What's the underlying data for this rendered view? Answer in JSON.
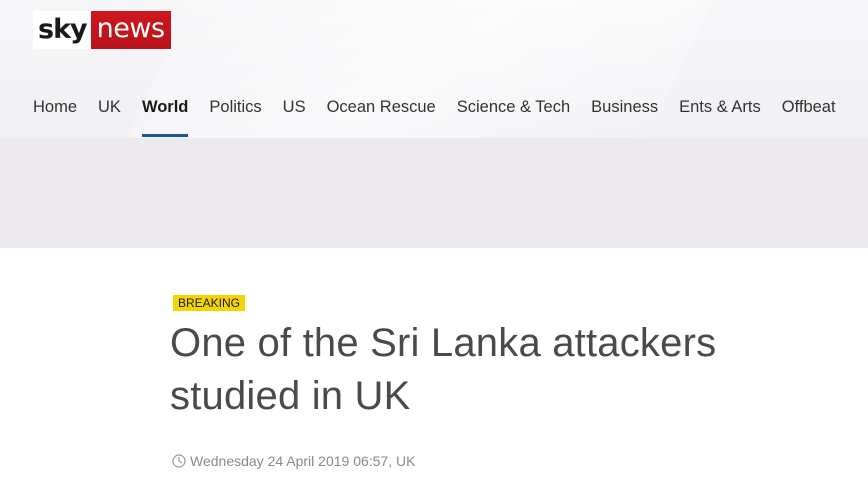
{
  "brand": {
    "logo_part1": "sky",
    "logo_part2": "news",
    "colors": {
      "news_red": "#c4131b",
      "active_underline": "#1a5694",
      "breaking_yellow": "#f5d500"
    }
  },
  "nav": {
    "items": [
      {
        "label": "Home",
        "active": false
      },
      {
        "label": "UK",
        "active": false
      },
      {
        "label": "World",
        "active": true
      },
      {
        "label": "Politics",
        "active": false
      },
      {
        "label": "US",
        "active": false
      },
      {
        "label": "Ocean Rescue",
        "active": false
      },
      {
        "label": "Science & Tech",
        "active": false
      },
      {
        "label": "Business",
        "active": false
      },
      {
        "label": "Ents & Arts",
        "active": false
      },
      {
        "label": "Offbeat",
        "active": false
      }
    ]
  },
  "article": {
    "badge": "BREAKING",
    "headline": "One of the Sri Lanka attackers studied in UK",
    "timestamp_icon": "clock-icon",
    "timestamp": "Wednesday 24 April 2019 06:57, UK"
  }
}
